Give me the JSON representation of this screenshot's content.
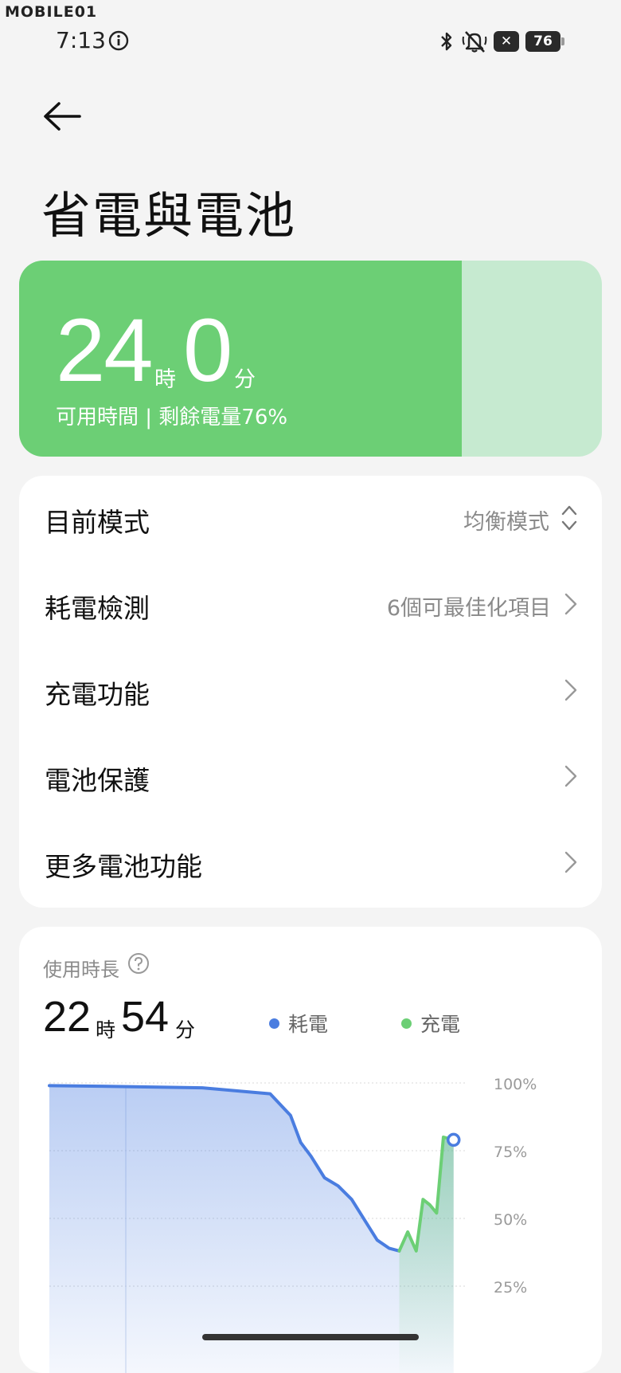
{
  "watermark": "MOBILE01",
  "status_bar": {
    "time": "7:13",
    "icons": [
      "info-icon",
      "bluetooth-icon",
      "mute-icon",
      "x-badge",
      "battery-icon"
    ],
    "x_badge": "✕",
    "battery_level": "76"
  },
  "header": {
    "back_icon": "back-arrow-icon",
    "title": "省電與電池"
  },
  "battery_card": {
    "hours": "24",
    "hours_unit": "時",
    "minutes": "0",
    "minutes_unit": "分",
    "subtitle": "可用時間 | 剩餘電量76%",
    "level_fraction": 0.76,
    "fill_color": "#6ccf75",
    "track_color": "#c6ead0"
  },
  "settings": {
    "rows": [
      {
        "label": "目前模式",
        "value": "均衡模式",
        "icon": "up-down-chevron-icon"
      },
      {
        "label": "耗電檢測",
        "value": "6個可最佳化項目",
        "icon": "chevron-right-icon"
      },
      {
        "label": "充電功能",
        "value": "",
        "icon": "chevron-right-icon"
      },
      {
        "label": "電池保護",
        "value": "",
        "icon": "chevron-right-icon"
      },
      {
        "label": "更多電池功能",
        "value": "",
        "icon": "chevron-right-icon"
      }
    ]
  },
  "usage": {
    "label": "使用時長",
    "help_icon": "question-circle-icon",
    "hours": "22",
    "hours_unit": "時",
    "minutes": "54",
    "minutes_unit": "分",
    "legend": [
      {
        "name": "耗電",
        "color": "#4a7de0"
      },
      {
        "name": "充電",
        "color": "#6ccf75"
      }
    ]
  },
  "chart_data": {
    "type": "line",
    "y_tick_labels": [
      "100%",
      "75%",
      "50%",
      "25%"
    ],
    "ylim": [
      0,
      100
    ],
    "grid": true,
    "x_index_range": [
      0,
      24
    ],
    "discharge": {
      "name": "耗電",
      "x": [
        0,
        3,
        6,
        9,
        13,
        14.2,
        14.8,
        15.4,
        16.2,
        17,
        17.8,
        18.6,
        19.3,
        20.0,
        20.6
      ],
      "y": [
        99,
        98.8,
        98.5,
        98.2,
        96,
        88,
        78,
        73,
        65,
        62,
        57,
        49,
        42,
        39,
        38
      ]
    },
    "charge": {
      "name": "充電",
      "x": [
        20.6,
        21.1,
        21.6,
        22.0,
        22.4,
        22.8,
        23.2,
        23.8
      ],
      "y": [
        38,
        45,
        38,
        57,
        55,
        52,
        80,
        79
      ]
    },
    "current_marker": {
      "x": 23.8,
      "y": 79
    }
  }
}
